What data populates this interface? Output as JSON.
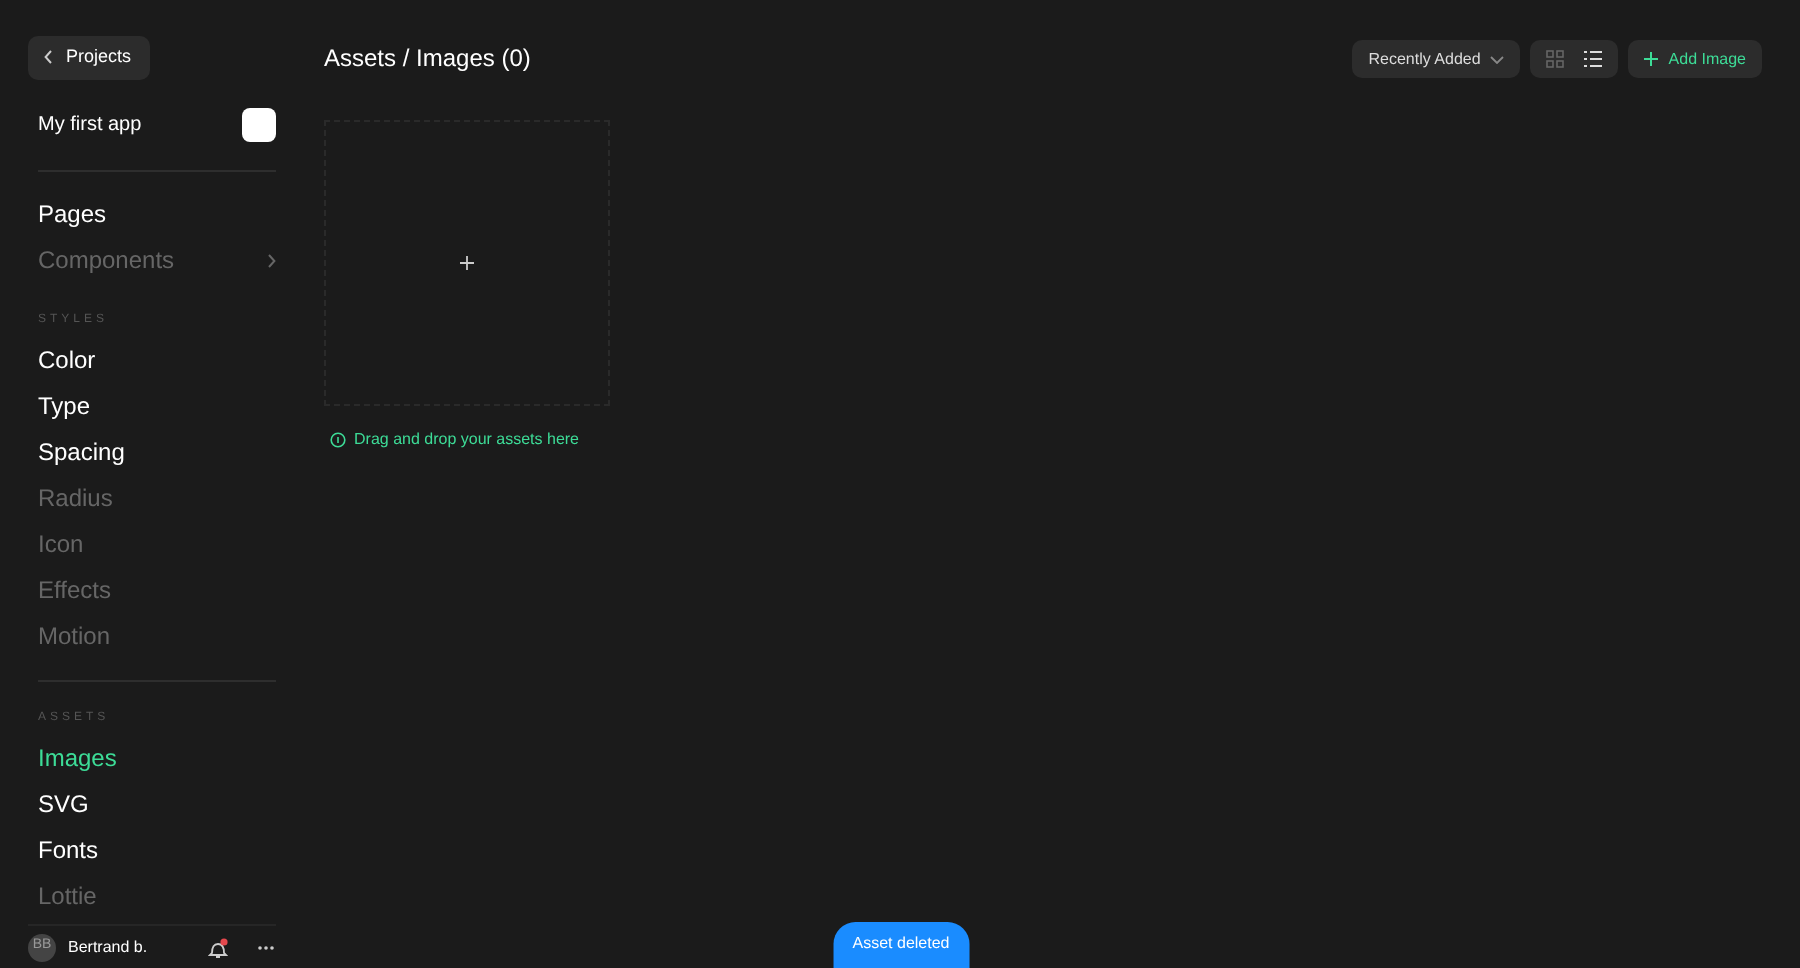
{
  "sidebar": {
    "back_button": {
      "label": "Projects"
    },
    "project": {
      "name": "My first app"
    },
    "top_items": [
      {
        "label": "Pages",
        "disabled": false,
        "selected": false,
        "submenu": false
      },
      {
        "label": "Components",
        "disabled": true,
        "selected": false,
        "submenu": true
      }
    ],
    "sections": [
      {
        "heading": "STYLES",
        "items": [
          {
            "label": "Color",
            "disabled": false,
            "selected": false,
            "submenu": false
          },
          {
            "label": "Type",
            "disabled": false,
            "selected": false,
            "submenu": false
          },
          {
            "label": "Spacing",
            "disabled": false,
            "selected": false,
            "submenu": false
          },
          {
            "label": "Radius",
            "disabled": true,
            "selected": false,
            "submenu": false
          },
          {
            "label": "Icon",
            "disabled": true,
            "selected": false,
            "submenu": false
          },
          {
            "label": "Effects",
            "disabled": true,
            "selected": false,
            "submenu": false
          },
          {
            "label": "Motion",
            "disabled": true,
            "selected": false,
            "submenu": false
          }
        ]
      },
      {
        "heading": "ASSETS",
        "items": [
          {
            "label": "Images",
            "disabled": false,
            "selected": true,
            "submenu": false
          },
          {
            "label": "SVG",
            "disabled": false,
            "selected": false,
            "submenu": false
          },
          {
            "label": "Fonts",
            "disabled": false,
            "selected": false,
            "submenu": false
          },
          {
            "label": "Lottie",
            "disabled": true,
            "selected": false,
            "submenu": false
          }
        ]
      }
    ],
    "user": {
      "initials": "BB",
      "name": "Bertrand b.",
      "notification": true
    }
  },
  "header": {
    "title": "Assets / Images (0)",
    "sort": "Recently Added",
    "views": [
      {
        "kind": "grid",
        "selected": false
      },
      {
        "kind": "list",
        "selected": true
      }
    ],
    "add_button": "Add Image"
  },
  "drop_hint": "Drag and drop your assets here",
  "toast": "Asset deleted"
}
